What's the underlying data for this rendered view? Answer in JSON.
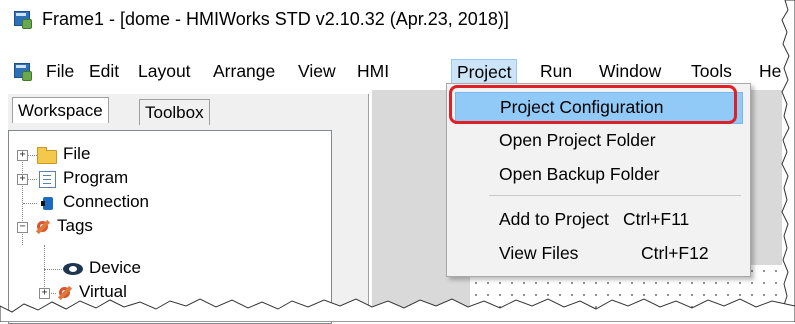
{
  "window": {
    "title": "Frame1 - [dome - HMIWorks STD v2.10.32 (Apr.23, 2018)]",
    "icon": "hmiworks-app-icon"
  },
  "menubar": {
    "items": [
      {
        "label": "File"
      },
      {
        "label": "Edit"
      },
      {
        "label": "Layout"
      },
      {
        "label": "Arrange"
      },
      {
        "label": "View"
      },
      {
        "label": "HMI"
      },
      {
        "label": "Project",
        "active": true
      },
      {
        "label": "Run"
      },
      {
        "label": "Window"
      },
      {
        "label": "Tools"
      },
      {
        "label": "He"
      }
    ]
  },
  "workspace": {
    "tabs": [
      {
        "label": "Workspace",
        "selected": true
      },
      {
        "label": "Toolbox",
        "selected": false
      }
    ],
    "tree": [
      {
        "label": "File",
        "icon": "folder-icon",
        "expander": "+"
      },
      {
        "label": "Program",
        "icon": "program-icon",
        "expander": "+"
      },
      {
        "label": "Connection",
        "icon": "connection-icon",
        "expander": ""
      },
      {
        "label": "Tags",
        "icon": "tags-icon",
        "expander": "−"
      },
      {
        "label": "Device",
        "icon": "device-icon",
        "expander": ""
      },
      {
        "label": "Virtual",
        "icon": "tags-icon",
        "expander": "+"
      }
    ]
  },
  "project_menu": {
    "items": [
      {
        "label": "Project Configuration",
        "shortcut": "",
        "highlighted": true
      },
      {
        "label": "Open Project Folder",
        "shortcut": ""
      },
      {
        "label": "Open Backup Folder",
        "shortcut": ""
      },
      {
        "label": "Add to Project",
        "shortcut": "Ctrl+F11"
      },
      {
        "label": "View Files",
        "shortcut": "Ctrl+F12"
      }
    ]
  },
  "colors": {
    "highlight_ring": "#e02027",
    "menu_hover": "#91c9f7",
    "active_menu": "#cce4f7"
  }
}
